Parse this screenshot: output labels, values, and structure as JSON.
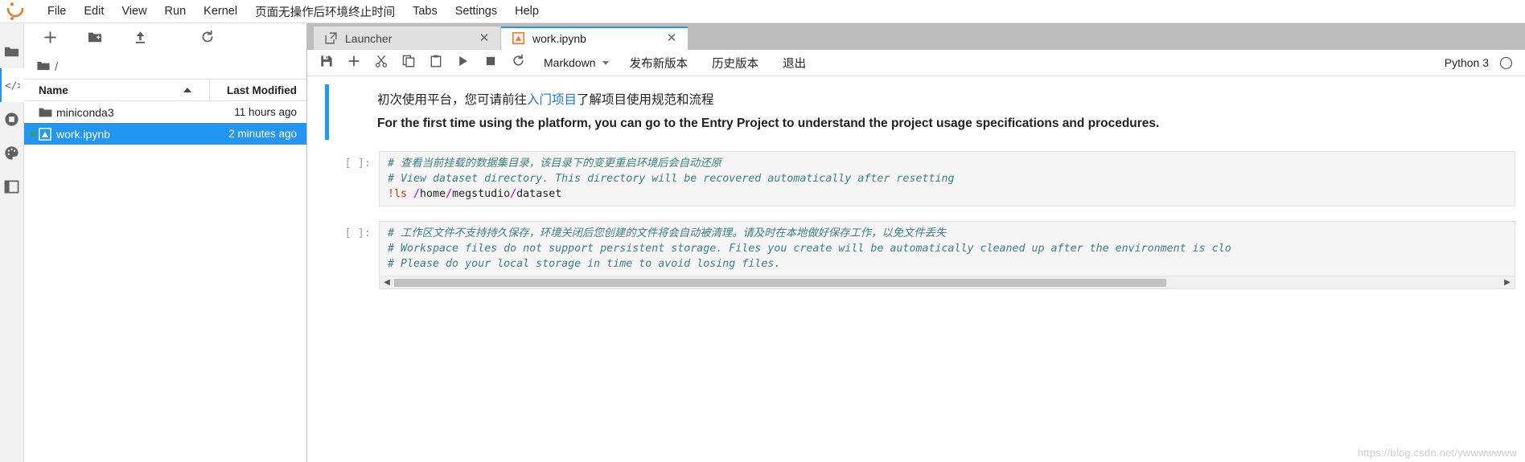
{
  "menubar": {
    "logo_name": "jupyter-logo",
    "items": [
      {
        "label": "File",
        "name": "menu-file"
      },
      {
        "label": "Edit",
        "name": "menu-edit"
      },
      {
        "label": "View",
        "name": "menu-view"
      },
      {
        "label": "Run",
        "name": "menu-run"
      },
      {
        "label": "Kernel",
        "name": "menu-kernel"
      },
      {
        "label": "页面无操作后环境终止时间",
        "name": "menu-idle-timeout"
      },
      {
        "label": "Tabs",
        "name": "menu-tabs"
      },
      {
        "label": "Settings",
        "name": "menu-settings"
      },
      {
        "label": "Help",
        "name": "menu-help"
      }
    ]
  },
  "rail": {
    "items": [
      {
        "name": "sidebar-file-browser",
        "icon": "folder-icon",
        "active": true
      },
      {
        "name": "sidebar-extension-code",
        "icon": "code-brackets-icon",
        "active": false
      },
      {
        "name": "sidebar-running-terminals",
        "icon": "stop-circle-icon",
        "active": false
      },
      {
        "name": "sidebar-extension-manager",
        "icon": "palette-icon",
        "active": false
      },
      {
        "name": "sidebar-table-of-contents",
        "icon": "toc-icon",
        "active": false
      }
    ]
  },
  "filebrowser": {
    "toolbar": [
      {
        "name": "new-launcher-button",
        "icon": "plus-icon"
      },
      {
        "name": "new-folder-button",
        "icon": "new-folder-icon"
      },
      {
        "name": "upload-button",
        "icon": "upload-icon"
      },
      {
        "name": "refresh-button",
        "icon": "refresh-icon"
      }
    ],
    "breadcrumb": {
      "root_icon": "folder-icon",
      "path": "/"
    },
    "columns": {
      "name": "Name",
      "last_modified": "Last Modified"
    },
    "rows": [
      {
        "name": "miniconda3",
        "modified": "11 hours ago",
        "icon": "folder-icon",
        "selected": false,
        "running": false
      },
      {
        "name": "work.ipynb",
        "modified": "2 minutes ago",
        "icon": "notebook-icon",
        "selected": true,
        "running": true
      }
    ]
  },
  "tabs": [
    {
      "label": "Launcher",
      "icon": "launcher-icon",
      "active": false,
      "close": "✕",
      "name": "tab-launcher"
    },
    {
      "label": "work.ipynb",
      "icon": "notebook-icon",
      "active": true,
      "close": "✕",
      "name": "tab-work-ipynb"
    }
  ],
  "nbtoolbar": {
    "buttons": [
      {
        "name": "save-button",
        "icon": "save-icon"
      },
      {
        "name": "insert-cell-button",
        "icon": "plus-icon"
      },
      {
        "name": "cut-cell-button",
        "icon": "scissors-icon"
      },
      {
        "name": "copy-cell-button",
        "icon": "copy-icon"
      },
      {
        "name": "paste-cell-button",
        "icon": "paste-icon"
      },
      {
        "name": "run-cell-button",
        "icon": "play-icon"
      },
      {
        "name": "interrupt-kernel-button",
        "icon": "stop-square-icon"
      },
      {
        "name": "restart-kernel-button",
        "icon": "refresh-icon"
      }
    ],
    "cell_type": "Markdown",
    "text_buttons": [
      {
        "label": "发布新版本",
        "name": "publish-new-version-button"
      },
      {
        "label": "历史版本",
        "name": "history-versions-button"
      },
      {
        "label": "退出",
        "name": "exit-button"
      }
    ],
    "kernel_name": "Python 3",
    "kernel_status": "idle"
  },
  "notebook": {
    "markdown_cell": {
      "prompt": "",
      "line_cn_pre": "初次使用平台，您可请前往",
      "line_cn_link": "入门项目",
      "line_cn_post": "了解项目使用规范和流程",
      "line_en": "For the first time using the platform, you can go to the Entry Project to understand the project usage specifications and procedures."
    },
    "code_cells": [
      {
        "prompt": "[ ]:",
        "lines": [
          {
            "type": "comment",
            "text": "# 查看当前挂载的数据集目录，该目录下的变更重启环境后会自动还原"
          },
          {
            "type": "comment",
            "text": "# View dataset directory. This directory will be recovered automatically after resetting"
          },
          {
            "type": "shell",
            "bang": "!ls ",
            "path_segments": [
              "/",
              "home",
              "/",
              "megstudio",
              "/",
              "dataset"
            ]
          }
        ]
      },
      {
        "prompt": "[ ]:",
        "lines": [
          {
            "type": "comment",
            "text": "# 工作区文件不支持持久保存，环境关闭后您创建的文件将会自动被清理。请及时在本地做好保存工作，以免文件丢失"
          },
          {
            "type": "comment",
            "text": "# Workspace files do not support persistent storage. Files you create will be automatically cleaned up after the environment is clo"
          },
          {
            "type": "comment",
            "text": "# Please do your local storage in time to avoid losing files."
          }
        ]
      }
    ],
    "hscrollbar": {
      "left_arrow": "◀",
      "right_arrow": "▶"
    }
  },
  "watermark": "https://blog.csdn.net/ywwwwwww",
  "colors": {
    "accent_blue": "#2196f3",
    "link_blue": "#1976d2",
    "tabbar_bg": "#bdbdbd",
    "rail_bg": "#f2f2f2",
    "code_bg": "#f5f5f5",
    "comment_green": "#408080",
    "bang_red": "#d63200",
    "op_magenta": "#b500b5",
    "running_green": "#43a047",
    "jupyter_orange": "#f37726"
  }
}
